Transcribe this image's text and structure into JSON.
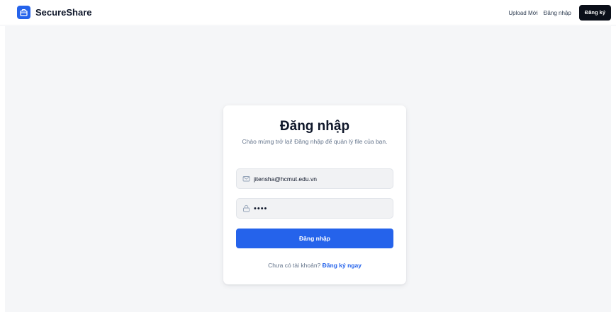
{
  "header": {
    "brand": "SecureShare",
    "nav": {
      "upload_label": "Upload Mới",
      "login_label": "Đăng nhập",
      "signup_label": "Đăng ký"
    }
  },
  "login_card": {
    "title": "Đăng nhập",
    "subtitle": "Chào mừng trở lại! Đăng nhập để quản lý file của bạn.",
    "email": {
      "value": "jitensha@hcmut.edu.vn",
      "icon": "mail-icon"
    },
    "password": {
      "value": "abcd",
      "icon": "lock-icon"
    },
    "submit_label": "Đăng nhập",
    "footer": {
      "prompt": "Chưa có tài khoản?",
      "link_label": "Đăng ký ngay"
    }
  },
  "colors": {
    "accent": "#2563eb",
    "dark_button": "#0b0f19",
    "background": "#f5f6f8"
  }
}
